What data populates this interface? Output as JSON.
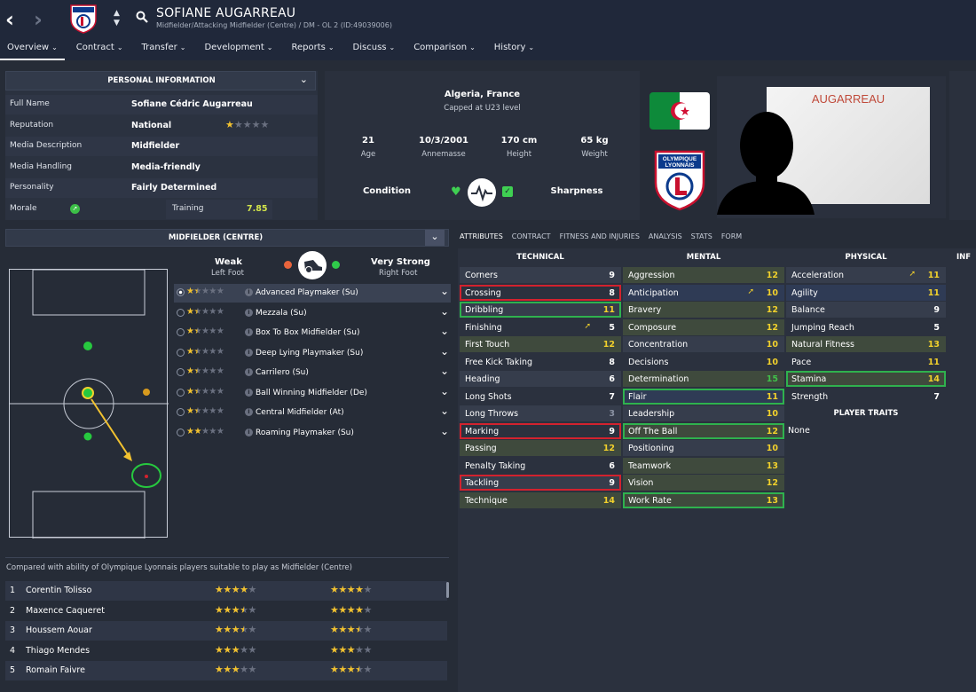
{
  "header": {
    "player_name": "SOFIANE AUGARREAU",
    "subtitle": "Midfielder/Attacking Midfielder (Centre) / DM - OL 2 (ID:49039006)",
    "tabs": [
      "Overview",
      "Contract",
      "Transfer",
      "Development",
      "Reports",
      "Discuss",
      "Comparison",
      "History"
    ]
  },
  "personal_info": {
    "title": "PERSONAL INFORMATION",
    "rows": [
      {
        "label": "Full Name",
        "value": "Sofiane Cédric Augarreau"
      },
      {
        "label": "Reputation",
        "value": "National"
      },
      {
        "label": "Media Description",
        "value": "Midfielder"
      },
      {
        "label": "Media Handling",
        "value": "Media-friendly"
      },
      {
        "label": "Personality",
        "value": "Fairly Determined"
      }
    ],
    "morale_label": "Morale",
    "training_label": "Training",
    "training_value": "7.85",
    "reputation_stars": 1.5
  },
  "bio": {
    "nationality": "Algeria, France",
    "capped": "Capped at U23 level",
    "stats": [
      {
        "value": "21",
        "label": "Age"
      },
      {
        "value": "10/3/2001",
        "label": "Annemasse"
      },
      {
        "value": "170 cm",
        "label": "Height"
      },
      {
        "value": "65 kg",
        "label": "Weight"
      }
    ],
    "condition_label": "Condition",
    "sharpness_label": "Sharpness",
    "photo_name": "AUGARREAU",
    "crest_text_1": "OLYMPIQUE",
    "crest_text_2": "LYONNAIS"
  },
  "position": {
    "title": "MIDFIELDER (CENTRE)",
    "left_foot_rating": "Weak",
    "left_foot_label": "Left Foot",
    "right_foot_rating": "Very Strong",
    "right_foot_label": "Right Foot",
    "roles": [
      {
        "name": "Advanced Playmaker (Su)",
        "stars": 1.5
      },
      {
        "name": "Mezzala (Su)",
        "stars": 1.5
      },
      {
        "name": "Box To Box Midfielder (Su)",
        "stars": 1.5
      },
      {
        "name": "Deep Lying Playmaker (Su)",
        "stars": 1.5
      },
      {
        "name": "Carrilero (Su)",
        "stars": 1.5
      },
      {
        "name": "Ball Winning Midfielder (De)",
        "stars": 1.5
      },
      {
        "name": "Central Midfielder (At)",
        "stars": 1.5
      },
      {
        "name": "Roaming Playmaker (Su)",
        "stars": 2
      }
    ]
  },
  "attributes": {
    "tabs": [
      "ATTRIBUTES",
      "CONTRACT",
      "FITNESS AND INJURIES",
      "ANALYSIS",
      "STATS",
      "FORM"
    ],
    "extra_header": "INF",
    "technical_title": "TECHNICAL",
    "mental_title": "MENTAL",
    "physical_title": "PHYSICAL",
    "technical": [
      {
        "name": "Corners",
        "value": "9",
        "hl": ""
      },
      {
        "name": "Crossing",
        "value": "8",
        "hl": "red"
      },
      {
        "name": "Dribbling",
        "value": "11",
        "hl": "grn"
      },
      {
        "name": "Finishing",
        "value": "5",
        "hl": "",
        "arrow": true
      },
      {
        "name": "First Touch",
        "value": "12",
        "hl": ""
      },
      {
        "name": "Free Kick Taking",
        "value": "8",
        "hl": ""
      },
      {
        "name": "Heading",
        "value": "6",
        "hl": ""
      },
      {
        "name": "Long Shots",
        "value": "7",
        "hl": ""
      },
      {
        "name": "Long Throws",
        "value": "3",
        "hl": ""
      },
      {
        "name": "Marking",
        "value": "9",
        "hl": "red"
      },
      {
        "name": "Passing",
        "value": "12",
        "hl": ""
      },
      {
        "name": "Penalty Taking",
        "value": "6",
        "hl": ""
      },
      {
        "name": "Tackling",
        "value": "9",
        "hl": "red"
      },
      {
        "name": "Technique",
        "value": "14",
        "hl": ""
      }
    ],
    "mental": [
      {
        "name": "Aggression",
        "value": "12",
        "hl": ""
      },
      {
        "name": "Anticipation",
        "value": "10",
        "hl": "",
        "arrow": true
      },
      {
        "name": "Bravery",
        "value": "12",
        "hl": ""
      },
      {
        "name": "Composure",
        "value": "12",
        "hl": ""
      },
      {
        "name": "Concentration",
        "value": "10",
        "hl": ""
      },
      {
        "name": "Decisions",
        "value": "10",
        "hl": ""
      },
      {
        "name": "Determination",
        "value": "15",
        "hl": ""
      },
      {
        "name": "Flair",
        "value": "11",
        "hl": "grn"
      },
      {
        "name": "Leadership",
        "value": "10",
        "hl": ""
      },
      {
        "name": "Off The Ball",
        "value": "12",
        "hl": "grn"
      },
      {
        "name": "Positioning",
        "value": "10",
        "hl": ""
      },
      {
        "name": "Teamwork",
        "value": "13",
        "hl": ""
      },
      {
        "name": "Vision",
        "value": "12",
        "hl": ""
      },
      {
        "name": "Work Rate",
        "value": "13",
        "hl": "grn"
      }
    ],
    "physical": [
      {
        "name": "Acceleration",
        "value": "11",
        "hl": "",
        "arrow": true
      },
      {
        "name": "Agility",
        "value": "11",
        "hl": ""
      },
      {
        "name": "Balance",
        "value": "9",
        "hl": ""
      },
      {
        "name": "Jumping Reach",
        "value": "5",
        "hl": ""
      },
      {
        "name": "Natural Fitness",
        "value": "13",
        "hl": ""
      },
      {
        "name": "Pace",
        "value": "11",
        "hl": ""
      },
      {
        "name": "Stamina",
        "value": "14",
        "hl": "grn"
      },
      {
        "name": "Strength",
        "value": "7",
        "hl": ""
      }
    ],
    "player_traits_title": "PLAYER TRAITS",
    "player_traits_value": "None"
  },
  "comparison": {
    "note": "Compared with ability of Olympique Lyonnais players suitable to play as Midfielder (Centre)",
    "players": [
      {
        "rank": "1",
        "name": "Corentin Tolisso",
        "ca": 4,
        "pa": 4
      },
      {
        "rank": "2",
        "name": "Maxence Caqueret",
        "ca": 3.5,
        "pa": 4
      },
      {
        "rank": "3",
        "name": "Houssem Aouar",
        "ca": 3.5,
        "pa": 3.5
      },
      {
        "rank": "4",
        "name": "Thiago Mendes",
        "ca": 3,
        "pa": 3
      },
      {
        "rank": "5",
        "name": "Romain Faivre",
        "ca": 3,
        "pa": 3.5
      }
    ]
  },
  "colors": {
    "attr_high": "#f2d12c",
    "attr_top": "#41c04a",
    "attr_normal": "#ffffff",
    "highlight_red": "#d3222e",
    "highlight_green": "#2fb24e",
    "star": "#f2c230"
  }
}
